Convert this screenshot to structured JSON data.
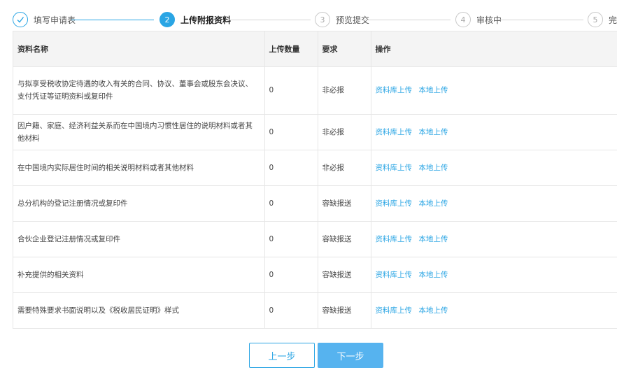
{
  "stepper": {
    "steps": [
      {
        "index": "",
        "label": "填写申请表",
        "state": "done"
      },
      {
        "index": "2",
        "label": "上传附报资料",
        "state": "active"
      },
      {
        "index": "3",
        "label": "预览提交",
        "state": "todo"
      },
      {
        "index": "4",
        "label": "审核中",
        "state": "todo"
      },
      {
        "index": "5",
        "label": "完成",
        "state": "todo"
      }
    ]
  },
  "table": {
    "headers": [
      "资料名称",
      "上传数量",
      "要求",
      "操作"
    ],
    "rows": [
      {
        "name": "与拟享受税收协定待遇的收入有关的合同、协议、董事会或股东会决议、支付凭证等证明资料或复印件",
        "count": "0",
        "requirement": "非必报"
      },
      {
        "name": "因户籍、家庭、经济利益关系而在中国境内习惯性居住的说明材料或者其他材料",
        "count": "0",
        "requirement": "非必报"
      },
      {
        "name": "在中国境内实际居住时间的相关说明材料或者其他材料",
        "count": "0",
        "requirement": "非必报"
      },
      {
        "name": "总分机构的登记注册情况或复印件",
        "count": "0",
        "requirement": "容缺报送"
      },
      {
        "name": "合伙企业登记注册情况或复印件",
        "count": "0",
        "requirement": "容缺报送"
      },
      {
        "name": "补充提供的相关资料",
        "count": "0",
        "requirement": "容缺报送"
      },
      {
        "name": "需要特殊要求书面说明以及《税收居民证明》样式",
        "count": "0",
        "requirement": "容缺报送"
      }
    ],
    "actions": {
      "library_upload": "资料库上传",
      "local_upload": "本地上传"
    }
  },
  "buttons": {
    "prev": "上一步",
    "next": "下一步"
  },
  "colors": {
    "accent": "#2aa5e4",
    "next_button": "#56b3ef"
  }
}
